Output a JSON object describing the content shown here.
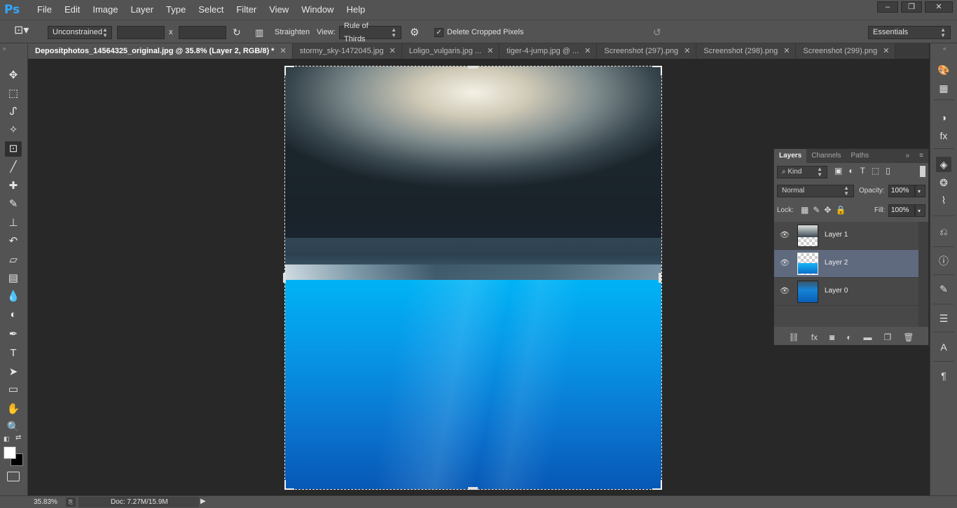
{
  "app": {
    "logo": "Ps"
  },
  "menu": [
    "File",
    "Edit",
    "Image",
    "Layer",
    "Type",
    "Select",
    "Filter",
    "View",
    "Window",
    "Help"
  ],
  "window_buttons": {
    "minimize": "–",
    "restore": "❐",
    "close": "✕"
  },
  "options": {
    "ratio_value": "Unconstrained",
    "width_value": "",
    "times": "x",
    "height_value": "",
    "straighten_label": "Straighten",
    "view_label": "View:",
    "view_value": "Rule of Thirds",
    "delete_cropped_label": "Delete Cropped Pixels",
    "delete_cropped_checked": true,
    "workspace": "Essentials"
  },
  "tabs": [
    {
      "label": "Depositphotos_14564325_original.jpg @ 35.8% (Layer 2, RGB/8) *",
      "close": "✕",
      "active": true
    },
    {
      "label": "stormy_sky-1472045.jpg",
      "close": "✕"
    },
    {
      "label": "Loligo_vulgaris.jpg ...",
      "close": "✕"
    },
    {
      "label": "tiger-4-jump.jpg @ ...",
      "close": "✕"
    },
    {
      "label": "Screenshot (297).png",
      "close": "✕"
    },
    {
      "label": "Screenshot (298).png",
      "close": "✕"
    },
    {
      "label": "Screenshot (299).png",
      "close": "✕"
    }
  ],
  "tools": [
    {
      "name": "move-tool-icon",
      "glyph": "✥"
    },
    {
      "name": "marquee-tool-icon",
      "glyph": "⬚"
    },
    {
      "name": "lasso-tool-icon",
      "glyph": "ᔑ"
    },
    {
      "name": "magic-wand-tool-icon",
      "glyph": "✧"
    },
    {
      "name": "crop-tool-icon",
      "glyph": "⊡"
    },
    {
      "name": "eyedropper-tool-icon",
      "glyph": "╱"
    },
    {
      "name": "healing-brush-tool-icon",
      "glyph": "✚"
    },
    {
      "name": "brush-tool-icon",
      "glyph": "✎"
    },
    {
      "name": "clone-stamp-tool-icon",
      "glyph": "⊥"
    },
    {
      "name": "history-brush-tool-icon",
      "glyph": "↶"
    },
    {
      "name": "eraser-tool-icon",
      "glyph": "▱"
    },
    {
      "name": "gradient-tool-icon",
      "glyph": "▤"
    },
    {
      "name": "blur-tool-icon",
      "glyph": "💧"
    },
    {
      "name": "dodge-tool-icon",
      "glyph": "◐"
    },
    {
      "name": "pen-tool-icon",
      "glyph": "✒"
    },
    {
      "name": "type-tool-icon",
      "glyph": "T"
    },
    {
      "name": "path-selection-tool-icon",
      "glyph": "➤"
    },
    {
      "name": "rectangle-tool-icon",
      "glyph": "▭"
    },
    {
      "name": "hand-tool-icon",
      "glyph": "✋"
    },
    {
      "name": "zoom-tool-icon",
      "glyph": "🔍"
    }
  ],
  "right_icons": [
    {
      "name": "color-panel-icon",
      "glyph": "🎨"
    },
    {
      "name": "swatches-panel-icon",
      "glyph": "▦"
    },
    {
      "name": "adjustments-panel-icon",
      "glyph": "◑"
    },
    {
      "name": "styles-panel-icon",
      "glyph": "fx"
    },
    {
      "name": "layers-panel-icon",
      "glyph": "◈"
    },
    {
      "name": "channels-panel-icon",
      "glyph": "❂"
    },
    {
      "name": "paths-panel-icon",
      "glyph": "⌇"
    },
    {
      "name": "history-panel-icon",
      "glyph": "⎌"
    },
    {
      "name": "info-panel-icon",
      "glyph": "ⓘ"
    },
    {
      "name": "brush-presets-panel-icon",
      "glyph": "✎"
    },
    {
      "name": "properties-panel-icon",
      "glyph": "☰"
    },
    {
      "name": "character-panel-icon",
      "glyph": "A"
    },
    {
      "name": "paragraph-panel-icon",
      "glyph": "¶"
    }
  ],
  "layers_panel": {
    "tabs": [
      "Layers",
      "Channels",
      "Paths"
    ],
    "filter_label": "Kind",
    "blend_mode": "Normal",
    "opacity_label": "Opacity:",
    "opacity_value": "100%",
    "lock_label": "Lock:",
    "fill_label": "Fill:",
    "fill_value": "100%",
    "layers": [
      {
        "name": "Layer 1",
        "selected": false
      },
      {
        "name": "Layer 2",
        "selected": true
      },
      {
        "name": "Layer 0",
        "selected": false
      }
    ]
  },
  "status": {
    "zoom": "35.83%",
    "doc": "Doc: 7.27M/15.9M"
  }
}
